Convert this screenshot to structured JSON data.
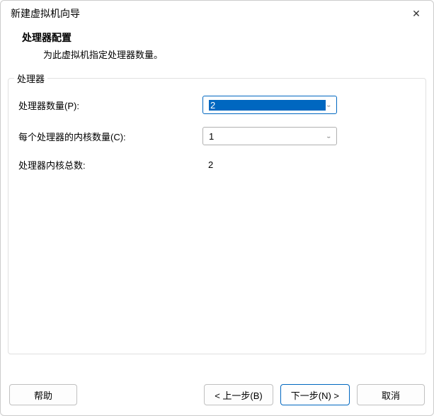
{
  "window": {
    "title": "新建虚拟机向导"
  },
  "header": {
    "heading": "处理器配置",
    "subheading": "为此虚拟机指定处理器数量。"
  },
  "group": {
    "legend": "处理器"
  },
  "fields": {
    "processor_count": {
      "label": "处理器数量(P):",
      "value": "2"
    },
    "cores_per_processor": {
      "label": "每个处理器的内核数量(C):",
      "value": "1"
    },
    "total_cores": {
      "label": "处理器内核总数:",
      "value": "2"
    }
  },
  "buttons": {
    "help": "帮助",
    "back": "< 上一步(B)",
    "next": "下一步(N) >",
    "cancel": "取消"
  },
  "icons": {
    "close": "✕",
    "chevron": "⌄"
  }
}
